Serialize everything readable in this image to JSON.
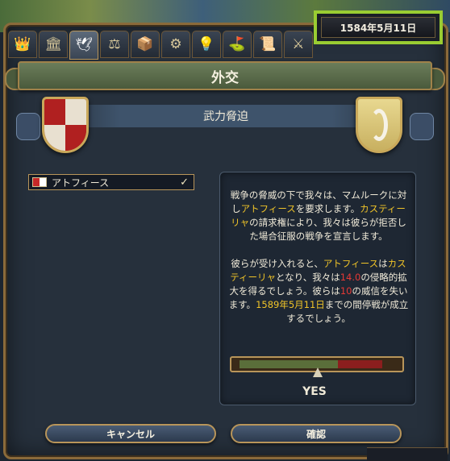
{
  "date": "1584年5月11日",
  "tabs": [
    {
      "name": "court-tab",
      "icon": "👑"
    },
    {
      "name": "government-tab",
      "icon": "🏛"
    },
    {
      "name": "diplomacy-tab",
      "icon": "🕊"
    },
    {
      "name": "economy-tab",
      "icon": "⚖"
    },
    {
      "name": "trade-tab",
      "icon": "📦"
    },
    {
      "name": "technology-tab",
      "icon": "⚙"
    },
    {
      "name": "ideas-tab",
      "icon": "💡"
    },
    {
      "name": "missions-tab",
      "icon": "⛳"
    },
    {
      "name": "decisions-tab",
      "icon": "📜"
    },
    {
      "name": "military-tab",
      "icon": "⚔"
    }
  ],
  "window_title": "外交",
  "subtitle": "武力脅迫",
  "target": {
    "name": "アトフィース",
    "check": "✓"
  },
  "description": {
    "p1_a": "戦争の脅威の下で我々は、マムルークに対し",
    "p1_target": "アトフィース",
    "p1_b": "を要求します。",
    "p1_country": "カスティーリャ",
    "p1_c": "の請求権により、我々は彼らが拒否した場合征服の戦争を宣言します。",
    "p2_a": "彼らが受け入れると、",
    "p2_target": "アトフィース",
    "p2_b": "は",
    "p2_country": "カスティーリャ",
    "p2_c": "となり、我々は",
    "p2_ae": "14.0",
    "p2_d": "の侵略的拡大を得るでしょう。彼らは",
    "p2_prestige": "10",
    "p2_e": "の威信を失います。",
    "p2_date": "1589年5月11日",
    "p2_f": "までの間停戦が成立するでしょう。"
  },
  "acceptance": {
    "label": "YES",
    "green_fraction": 0.62,
    "red_fraction": 0.28
  },
  "buttons": {
    "cancel": "キャンセル",
    "confirm": "確認"
  }
}
